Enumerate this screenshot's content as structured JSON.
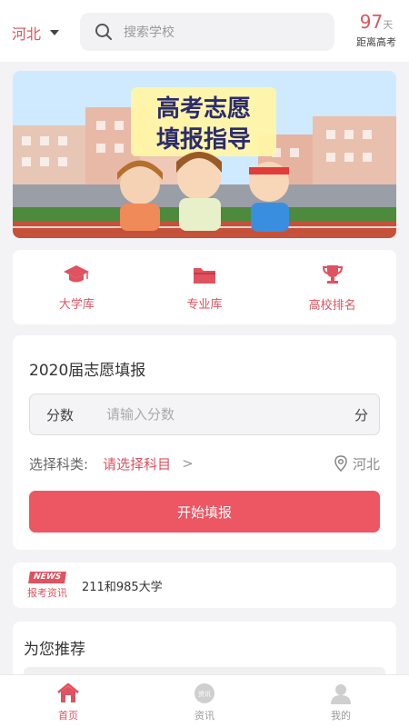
{
  "header": {
    "region": "河北",
    "search_placeholder": "搜索学校",
    "countdown_days": "97",
    "countdown_unit": "天",
    "countdown_label": "距离高考"
  },
  "banner": {
    "text_line1": "高考志愿",
    "text_line2": "填报指导"
  },
  "features": [
    {
      "label": "大学库",
      "icon": "graduation-cap-icon"
    },
    {
      "label": "专业库",
      "icon": "folder-icon"
    },
    {
      "label": "高校排名",
      "icon": "trophy-icon"
    }
  ],
  "form": {
    "title": "2020届志愿填报",
    "score_label": "分数",
    "score_placeholder": "请输入分数",
    "score_unit": "分",
    "subject_label": "选择科类:",
    "subject_pick": "请选择科目",
    "location": "河北",
    "start_button": "开始填报"
  },
  "news": {
    "badge_top": "NEWS",
    "badge_bottom": "报考资讯",
    "headline": "211和985大学"
  },
  "recommend": {
    "title": "为您推荐"
  },
  "tabbar": [
    {
      "label": "首页",
      "icon": "home-icon",
      "active": true
    },
    {
      "label": "资讯",
      "icon": "news-icon",
      "active": false
    },
    {
      "label": "我的",
      "icon": "user-icon",
      "active": false
    }
  ],
  "colors": {
    "accent": "#e0525f",
    "button": "#ec5763",
    "background": "#f3f3f5"
  }
}
